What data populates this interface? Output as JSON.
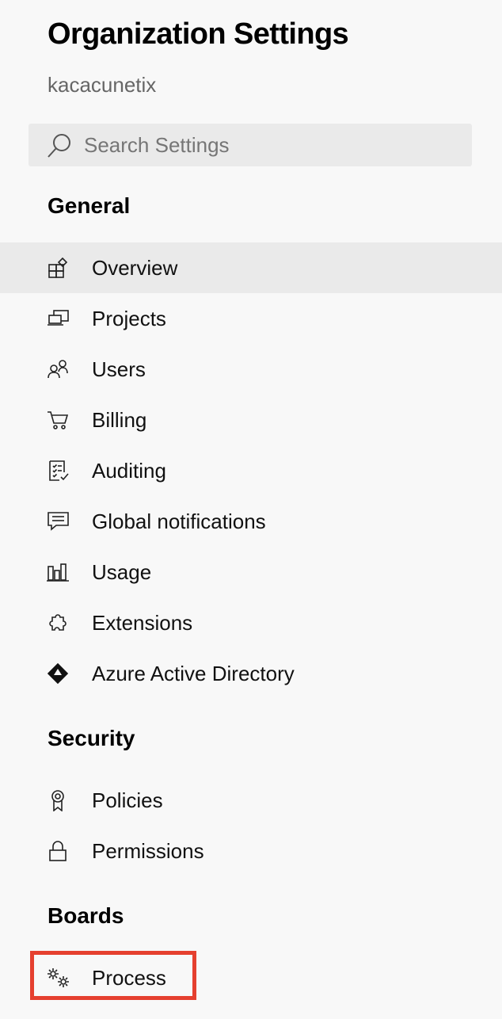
{
  "header": {
    "title": "Organization Settings",
    "org_name": "kacacunetix"
  },
  "search": {
    "placeholder": "Search Settings",
    "value": ""
  },
  "sections": {
    "general": "General",
    "security": "Security",
    "boards": "Boards"
  },
  "items": {
    "overview": {
      "label": "Overview",
      "icon": "overview-icon",
      "selected": true
    },
    "projects": {
      "label": "Projects",
      "icon": "projects-icon"
    },
    "users": {
      "label": "Users",
      "icon": "users-icon"
    },
    "billing": {
      "label": "Billing",
      "icon": "cart-icon"
    },
    "auditing": {
      "label": "Auditing",
      "icon": "checklist-icon"
    },
    "global_notifications": {
      "label": "Global notifications",
      "icon": "chat-icon"
    },
    "usage": {
      "label": "Usage",
      "icon": "bar-chart-icon"
    },
    "extensions": {
      "label": "Extensions",
      "icon": "puzzle-icon"
    },
    "azure_ad": {
      "label": "Azure Active Directory",
      "icon": "azure-ad-icon"
    },
    "policies": {
      "label": "Policies",
      "icon": "ribbon-icon"
    },
    "permissions": {
      "label": "Permissions",
      "icon": "lock-icon"
    },
    "process": {
      "label": "Process",
      "icon": "gears-icon"
    }
  },
  "colors": {
    "highlight": "#e5402f",
    "background": "#f8f8f8",
    "selected": "#eaeaea"
  }
}
